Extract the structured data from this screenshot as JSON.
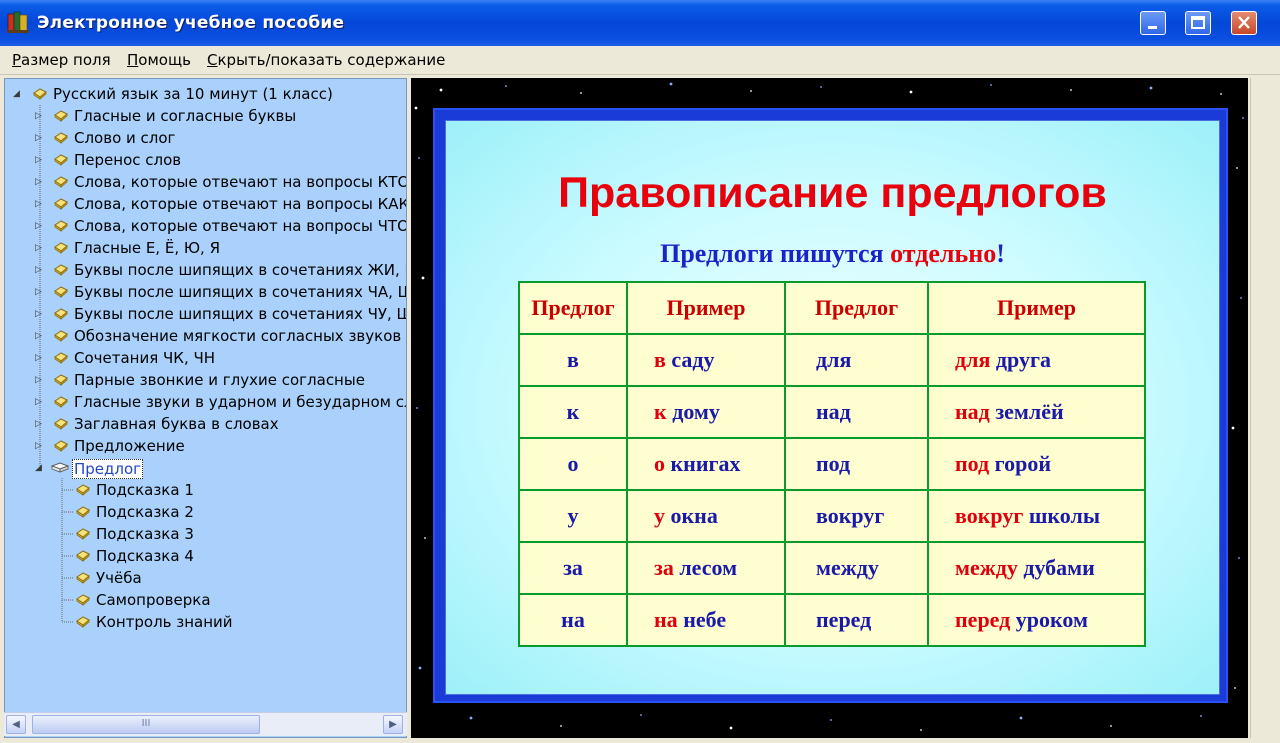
{
  "window": {
    "title": "Электронное учебное пособие"
  },
  "menu": [
    {
      "label": "Размер поля",
      "u": "Р",
      "rest": "азмер поля"
    },
    {
      "label": "Помощь",
      "u": "П",
      "rest": "омощь"
    },
    {
      "label": "Скрыть/показать содержание",
      "u": "С",
      "rest": "крыть/показать содержание"
    }
  ],
  "tree": {
    "root": "Русский язык за 10 минут (1 класс)",
    "items": [
      "Гласные и согласные буквы",
      "Слово и слог",
      "Перенос слов",
      "Слова, которые отвечают на вопросы КТО?",
      "Слова, которые отвечают на вопросы КАКС",
      "Слова, которые отвечают на вопросы ЧТО ,",
      "Гласные Е, Ё, Ю, Я",
      "Буквы после шипящих в сочетаниях ЖИ, ШИ",
      "Буквы после шипящих в сочетаниях ЧА, ЩА",
      "Буквы после шипящих в сочетаниях ЧУ, ЩУ",
      "Обозначение мягкости согласных звуков на",
      "Сочетания ЧК, ЧН",
      "Парные звонкие и глухие согласные",
      "Гласные звуки в ударном и безударном слог",
      "Заглавная буква в словах",
      "Предложение"
    ],
    "selected": "Предлог",
    "children": [
      "Подсказка 1",
      "Подсказка 2",
      "Подсказка 3",
      "Подсказка 4",
      "Учёба",
      "Самопроверка",
      "Контроль знаний"
    ]
  },
  "slide": {
    "title": "Правописание предлогов",
    "subtitle_a": "Предлоги пишутся ",
    "subtitle_b": "отдельно",
    "subtitle_c": "!",
    "headers": [
      "Предлог",
      "Пример",
      "Предлог",
      "Пример"
    ],
    "rows": [
      {
        "p1": "в",
        "e1a": "в",
        "e1b": " саду",
        "p2": "для",
        "e2a": "для",
        "e2b": " друга"
      },
      {
        "p1": "к",
        "e1a": "к",
        "e1b": " дому",
        "p2": "над",
        "e2a": "над",
        "e2b": " землёй"
      },
      {
        "p1": "о",
        "e1a": "о",
        "e1b": " книгах",
        "p2": "под",
        "e2a": "под",
        "e2b": " горой"
      },
      {
        "p1": "у",
        "e1a": "у",
        "e1b": " окна",
        "p2": "вокруг",
        "e2a": "вокруг",
        "e2b": " школы"
      },
      {
        "p1": "за",
        "e1a": "за",
        "e1b": " лесом",
        "p2": "между",
        "e2a": "между",
        "e2b": " дубами"
      },
      {
        "p1": "на",
        "e1a": "на",
        "e1b": " небе",
        "p2": "перед",
        "e2a": "перед",
        "e2b": " уроком"
      }
    ]
  },
  "scrollbar": {
    "thumb_glyph": "III"
  }
}
